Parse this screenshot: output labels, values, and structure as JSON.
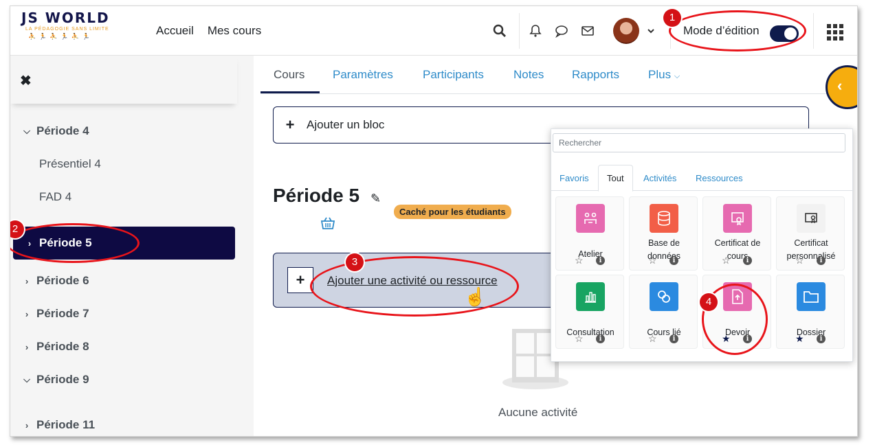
{
  "navbar": {
    "logo_title": "JS WORLD",
    "logo_subtitle": "LA PÉDAGOGIE SANS LIMITE",
    "links": [
      "Accueil",
      "Mes cours"
    ],
    "edit_mode_label": "Mode d’édition",
    "edit_mode_on": true
  },
  "drawer": {
    "items": [
      {
        "label": "Période 4",
        "type": "section",
        "expanded": true
      },
      {
        "label": "Présentiel 4",
        "type": "sub"
      },
      {
        "label": "FAD 4",
        "type": "sub"
      },
      {
        "label": "Période 5",
        "type": "section",
        "active": true
      },
      {
        "label": "Période 6",
        "type": "section"
      },
      {
        "label": "Période 7",
        "type": "section"
      },
      {
        "label": "Période 8",
        "type": "section"
      },
      {
        "label": "Période 9",
        "type": "section",
        "expanded": true
      },
      {
        "label": "Période 11",
        "type": "section"
      }
    ]
  },
  "secondary_nav": {
    "tabs": [
      "Cours",
      "Paramètres",
      "Participants",
      "Notes",
      "Rapports",
      "Plus"
    ],
    "active_tab": "Cours"
  },
  "main": {
    "add_block_label": "Ajouter un bloc",
    "section_title": "Période 5",
    "hidden_badge": "Caché pour les étudiants",
    "add_activity_label": "Ajouter une activité ou ressource",
    "empty_label": "Aucune activité"
  },
  "chooser": {
    "search_placeholder": "Rechercher",
    "tabs": [
      "Favoris",
      "Tout",
      "Activités",
      "Ressources"
    ],
    "active_tab": "Tout",
    "modules": [
      {
        "name": "Atelier",
        "color": "#e66ab0",
        "icon": "workshop-icon",
        "starred": false
      },
      {
        "name": "Base de données",
        "color": "#f25e47",
        "icon": "database-icon",
        "starred": false
      },
      {
        "name": "Certificat de cours",
        "color": "#e66ab0",
        "icon": "certificate-icon",
        "starred": false
      },
      {
        "name": "Certificat personnalisé",
        "color": "#f2f2f2",
        "icon": "custom-certificate-icon",
        "starred": false
      },
      {
        "name": "Consultation",
        "color": "#18a462",
        "icon": "chart-icon",
        "starred": false
      },
      {
        "name": "Cours lié",
        "color": "#2b8ae0",
        "icon": "linked-course-icon",
        "starred": false
      },
      {
        "name": "Devoir",
        "color": "#e66ab0",
        "icon": "assignment-icon",
        "starred": true
      },
      {
        "name": "Dossier",
        "color": "#2b8ae0",
        "icon": "folder-icon",
        "starred": true
      }
    ]
  },
  "annotations": [
    "1",
    "2",
    "3",
    "4"
  ],
  "colors": {
    "primary": "#0f1b4c",
    "link": "#2e8bc9",
    "annotation": "#e8141a",
    "badge": "#f0ad4e",
    "drawer_toggle": "#f6ad0e"
  }
}
